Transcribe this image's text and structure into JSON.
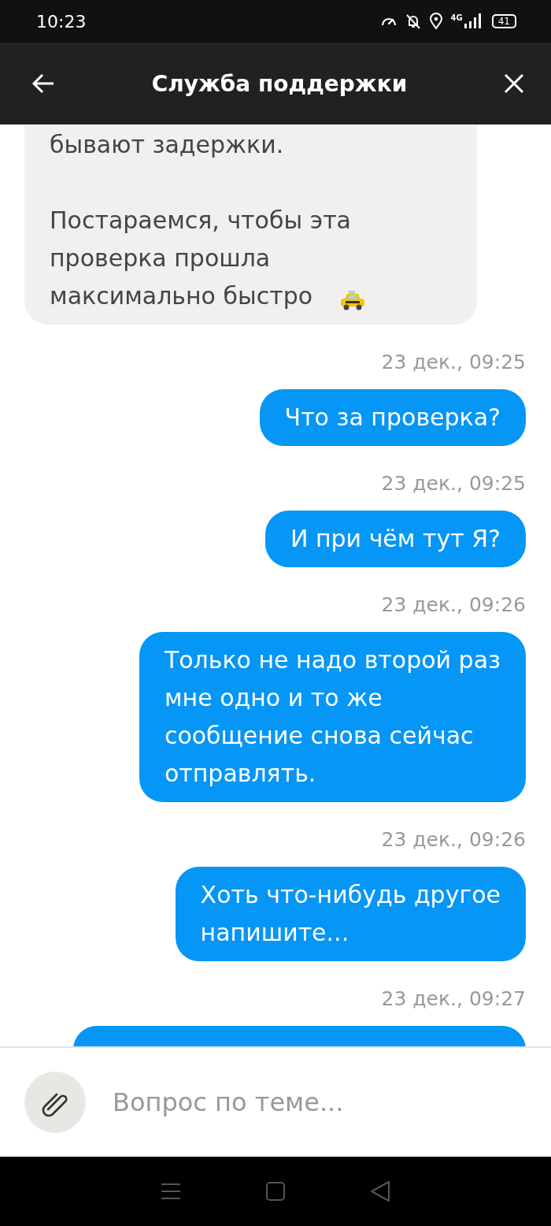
{
  "status_bar": {
    "time": "10:23",
    "network": "4G",
    "battery": "41"
  },
  "header": {
    "title": "Служба поддержки"
  },
  "messages": [
    {
      "kind": "incoming",
      "text": "бывают задержки.\n\nПостараемся, чтобы эта\nпроверка прошла\nмаксимально быстро"
    },
    {
      "kind": "outgoing",
      "time": "23 дек., 09:25",
      "text": "Что за проверка?"
    },
    {
      "kind": "outgoing",
      "time": "23 дек., 09:25",
      "text": "И при чём тут Я?"
    },
    {
      "kind": "outgoing",
      "time": "23 дек., 09:26",
      "text": "Только не надо второй раз\nмне одно и то же\nсообщение снова сейчас\nотправлять."
    },
    {
      "kind": "outgoing",
      "time": "23 дек., 09:26",
      "text": "Хоть что-нибудь другое\nнапишите..."
    },
    {
      "kind": "outgoing",
      "time": "23 дек., 09:27"
    }
  ],
  "composer": {
    "placeholder": "Вопрос по теме..."
  }
}
